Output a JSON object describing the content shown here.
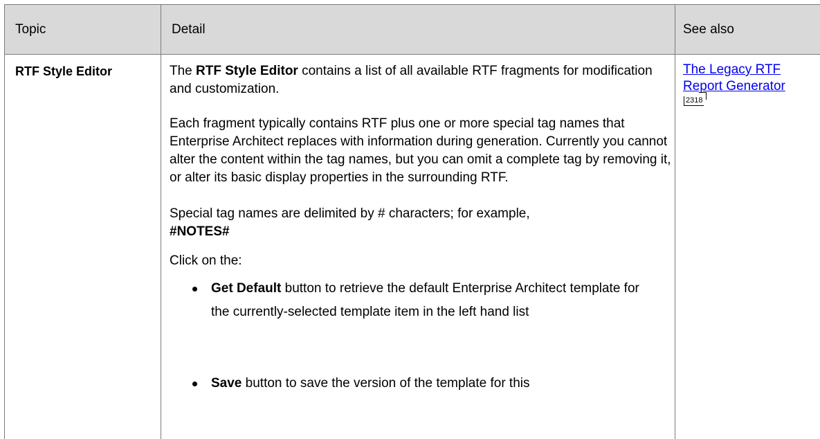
{
  "table": {
    "headers": {
      "topic": "Topic",
      "detail": "Detail",
      "see_also": "See also"
    },
    "row": {
      "topic": "RTF Style Editor",
      "detail": {
        "p1_pre": "The ",
        "p1_bold": "RTF Style Editor",
        "p1_post": " contains a list of all available RTF fragments for modification and customization.",
        "p2": "Each fragment typically contains RTF plus one or more special tag names that Enterprise Architect replaces with information during generation. Currently you cannot alter the content within the tag names, but you can omit a complete tag by removing it, or alter its basic display properties in the surrounding RTF.",
        "p3_pre": "Special tag names are delimited by # characters; for example,",
        "p3_bold": "#NOTES#",
        "p4": "Click on the:",
        "bullets": [
          {
            "bold": "Get Default",
            "text": " button to retrieve the default Enterprise Architect template for the currently-selected template item in the left hand list"
          },
          {
            "bold": "Save",
            "text": " button to save the version of the template for this"
          }
        ]
      },
      "see_also": {
        "link_line1": "The Legacy RTF",
        "link_line2": "Report Generator",
        "page_ref": "2318"
      }
    }
  }
}
